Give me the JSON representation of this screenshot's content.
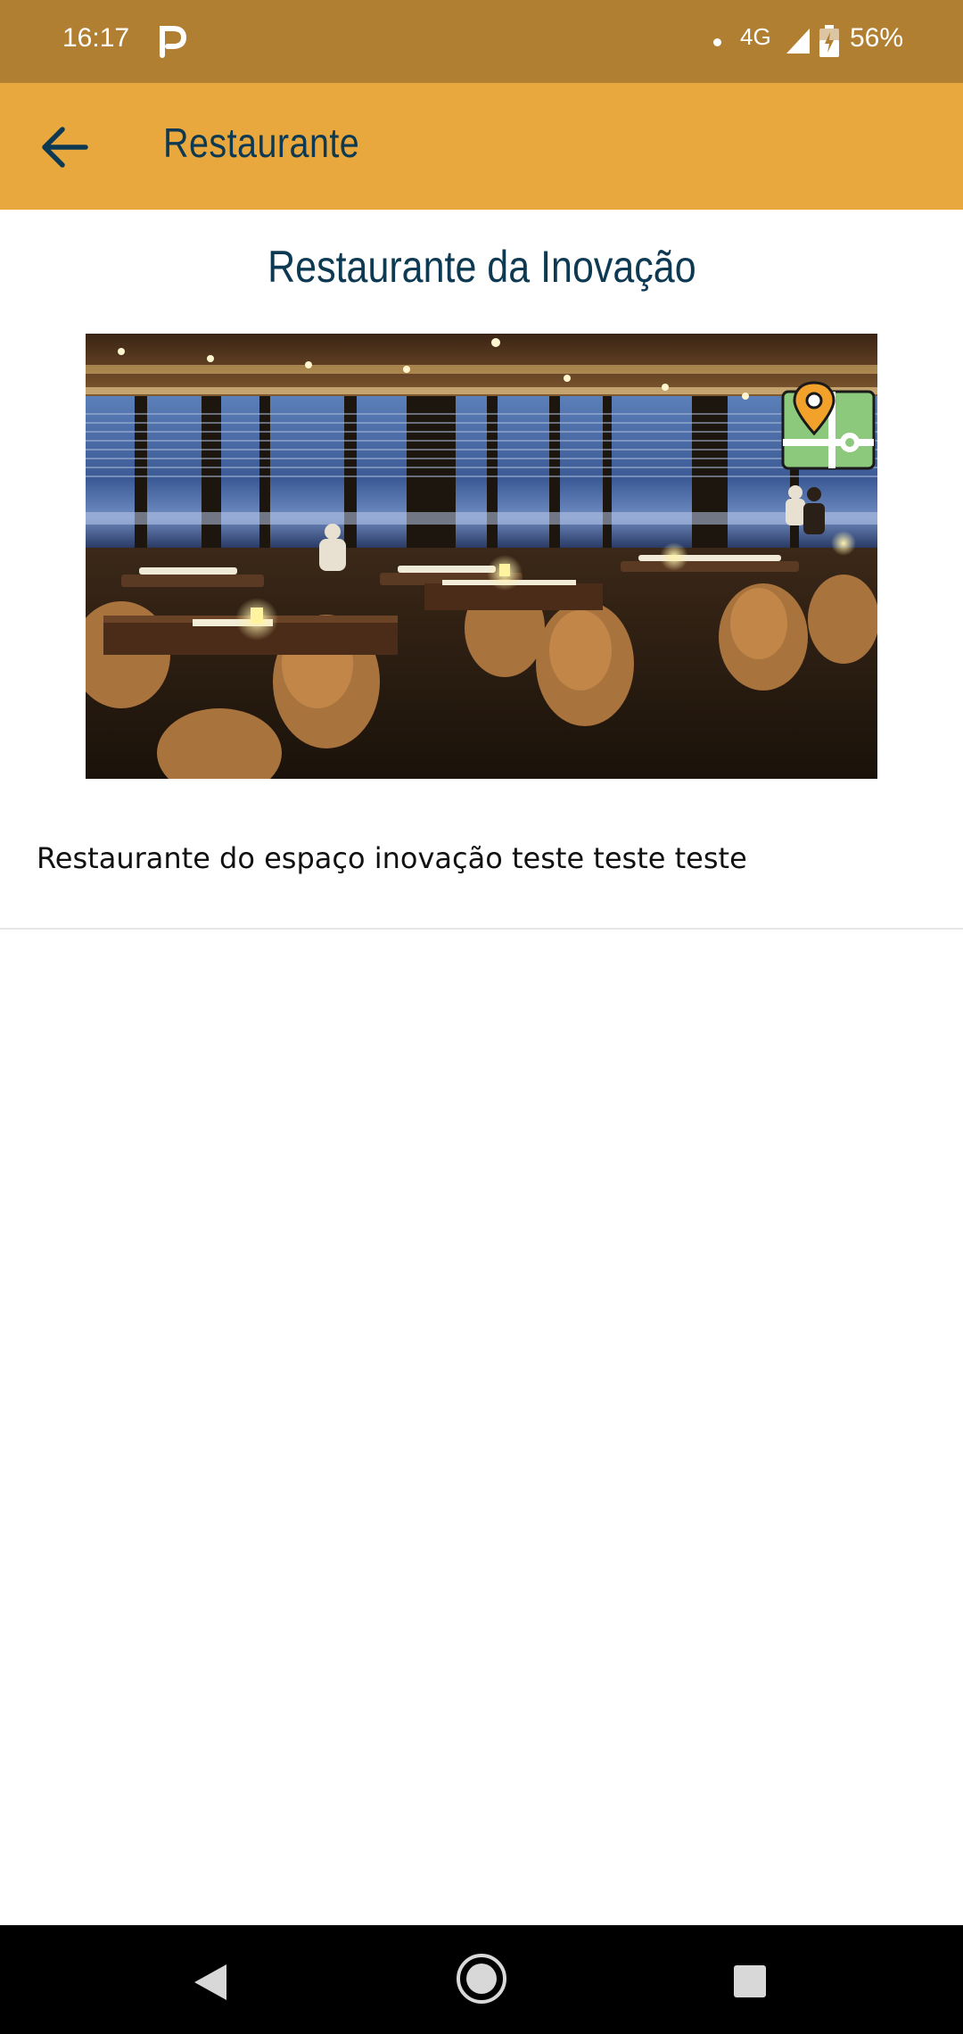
{
  "status_bar": {
    "time": "16:17",
    "network": "4G",
    "battery": "56%"
  },
  "app_bar": {
    "title": "Restaurante",
    "back_icon": "arrow-left-icon"
  },
  "content": {
    "title": "Restaurante da Inovação",
    "image_subject": "restaurant dining room with city view",
    "map_icon": "map-pin-icon",
    "description": "Restaurante do espaço inovação teste teste teste"
  },
  "colors": {
    "status_bar": "#b07f32",
    "app_bar": "#e8a83e",
    "title_text": "#0d3a52",
    "map_green": "#8cc97c",
    "pin_orange": "#f2a12b"
  },
  "nav_bar": {
    "back_icon": "triangle-back-icon",
    "home_icon": "circle-home-icon",
    "recents_icon": "square-recents-icon"
  }
}
